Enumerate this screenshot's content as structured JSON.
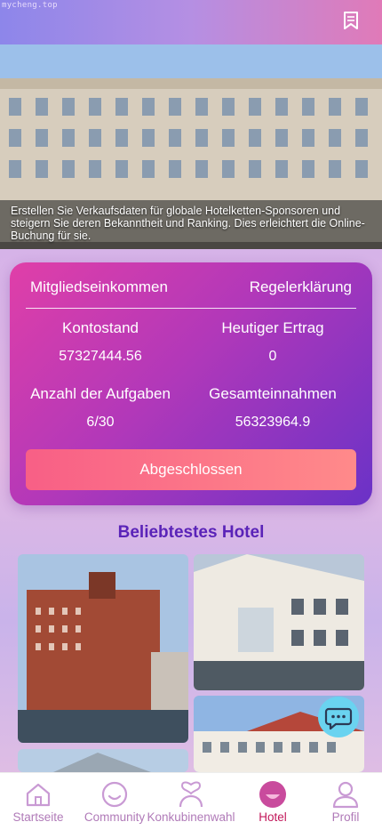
{
  "watermark": "mycheng.top",
  "banner": {
    "caption": "Erstellen Sie Verkaufsdaten für globale Hotelketten-Sponsoren und steigern Sie deren Bekanntheit und Ranking. Dies erleichtert die Online-Buchung für sie."
  },
  "card": {
    "title": "Mitgliedseinkommen",
    "rules_link": "Regelerklärung",
    "stats": [
      {
        "label": "Kontostand",
        "value": "57327444.56"
      },
      {
        "label": "Heutiger Ertrag",
        "value": "0"
      },
      {
        "label": "Anzahl der Aufgaben",
        "value": "6/30"
      },
      {
        "label": "Gesamteinnahmen",
        "value": "56323964.9"
      }
    ],
    "button": "Abgeschlossen"
  },
  "popular": {
    "title": "Beliebtestes Hotel"
  },
  "tabs": [
    {
      "label": "Startseite",
      "icon": "home-icon"
    },
    {
      "label": "Community",
      "icon": "smile-icon"
    },
    {
      "label": "Konkubinenwahl",
      "icon": "heart-person-icon"
    },
    {
      "label": "Hotel",
      "icon": "hotel-icon",
      "active": true
    },
    {
      "label": "Profil",
      "icon": "profile-icon"
    }
  ],
  "colors": {
    "accent_title": "#5a23b8",
    "tab_label": "#b07ab8",
    "tab_active": "#c2185b",
    "button": "#f85f86"
  }
}
